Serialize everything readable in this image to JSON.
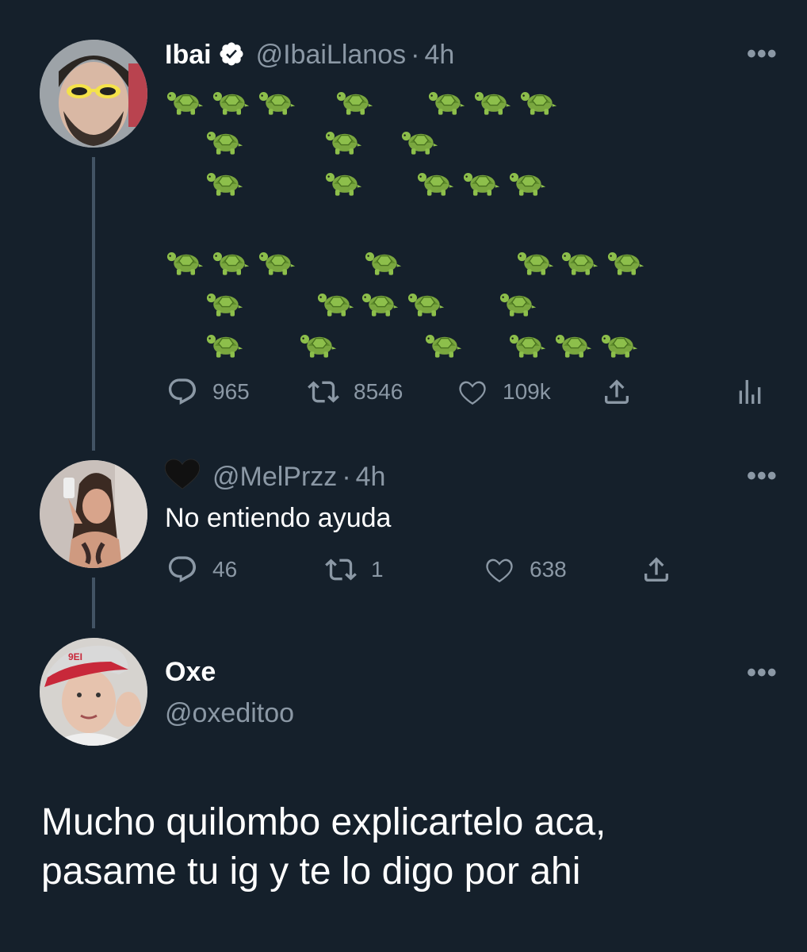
{
  "tweet1": {
    "name": "Ibai",
    "handle": "@IbaiLlanos",
    "dot": "·",
    "time": "4h",
    "turtle_emoji": "🐢",
    "actions": {
      "replies": "965",
      "retweets": "8546",
      "likes": "109k"
    }
  },
  "tweet2": {
    "name_emoji": "🖤",
    "handle": "@MelPrzz",
    "dot": "·",
    "time": "4h",
    "text": "No entiendo ayuda",
    "actions": {
      "replies": "46",
      "retweets": "1",
      "likes": "638"
    }
  },
  "tweet3": {
    "name": "Oxe",
    "handle": "@oxeditoo",
    "text_line1": "Mucho quilombo explicartelo aca,",
    "text_line2": "pasame tu ig y te lo digo por ahi"
  },
  "icons": {
    "more": "•••",
    "reply": "reply-icon",
    "retweet": "retweet-icon",
    "like": "heart-icon",
    "share": "share-icon",
    "analytics": "analytics-icon"
  },
  "colors": {
    "background": "#15202b",
    "muted": "#8b98a5",
    "verified": "#ffffff",
    "turtle": "#6c9b3a"
  }
}
